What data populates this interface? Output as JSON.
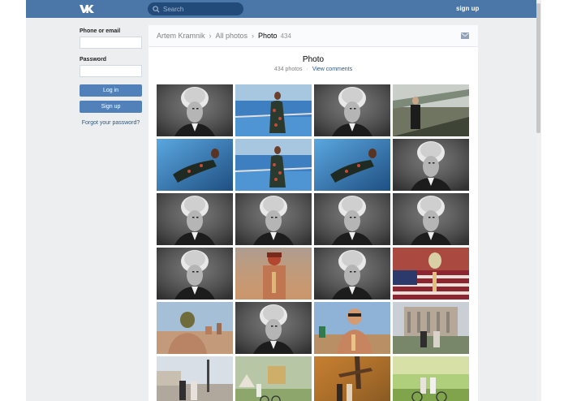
{
  "header": {
    "logo": "vk-logo-icon",
    "search_placeholder": "Search",
    "signup_label": "sign up"
  },
  "login": {
    "phone_label": "Phone or email",
    "password_label": "Password",
    "login_button": "Log in",
    "signup_button": "Sign up",
    "forgot_link": "Forgot your password?"
  },
  "breadcrumb": {
    "owner": "Artem Kramnik",
    "section": "All photos",
    "current": "Photo",
    "count": "434"
  },
  "album": {
    "title": "Photo",
    "photo_count": "434 photos",
    "comments_link": "View comments"
  },
  "photos": [
    "portrait-bw",
    "woman-pool",
    "portrait-bw",
    "man-bridge",
    "woman-pool-lying",
    "woman-pool",
    "woman-pool-lying",
    "portrait-bw",
    "portrait-bw",
    "portrait-bw",
    "portrait-bw",
    "portrait-bw",
    "portrait-bw",
    "masked-man",
    "portrait-bw",
    "masked-flag",
    "masked-city",
    "portrait-bw",
    "man-glasses",
    "couple-building",
    "couple-square",
    "couple-bike-tent",
    "couple-autumn",
    "couple-bike"
  ],
  "colors": {
    "topbar": "#4a76a8",
    "button": "#5181b8",
    "link": "#2a5885",
    "background": "#edeef0"
  }
}
